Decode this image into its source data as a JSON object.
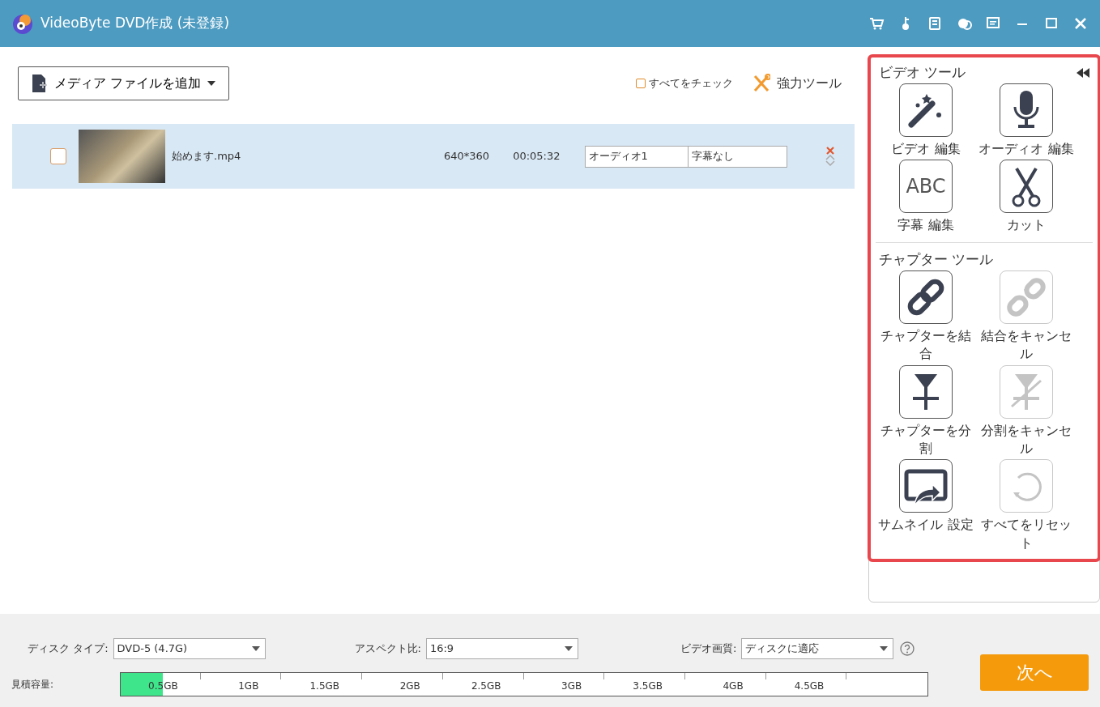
{
  "window": {
    "title": "VideoByte DVD作成 (未登録)"
  },
  "toolbar": {
    "add_media": "メディア ファイルを追加",
    "check_all": {
      "label": "すべてをチェック",
      "checked": false
    },
    "power_tools": "強力ツール"
  },
  "files": [
    {
      "name": "始めます.mp4",
      "resolution": "640*360",
      "duration": "00:05:32",
      "audio": "オーディオ1",
      "subtitle": "字幕なし",
      "checked": false,
      "selected": true
    }
  ],
  "tool_panel": {
    "sections": [
      {
        "title": "ビデオ ツール",
        "tools": [
          {
            "kind": "wand",
            "label": "ビデオ 編集",
            "disabled": false
          },
          {
            "kind": "mic",
            "label": "オーディオ 編集",
            "disabled": false
          },
          {
            "kind": "abc",
            "glyph": "ABC",
            "label": "字幕 編集",
            "disabled": false
          },
          {
            "kind": "scissors",
            "label": "カット",
            "disabled": false
          }
        ]
      },
      {
        "title": "チャプター ツール",
        "tools": [
          {
            "kind": "link",
            "label": "チャプターを結合",
            "disabled": false
          },
          {
            "kind": "unlink",
            "label": "結合をキャンセル",
            "disabled": true
          },
          {
            "kind": "split",
            "label": "チャプターを分割",
            "disabled": false
          },
          {
            "kind": "unsplit",
            "label": "分割をキャンセル",
            "disabled": true
          },
          {
            "kind": "thumb",
            "label": "サムネイル 設定",
            "disabled": false
          },
          {
            "kind": "reset",
            "label": "すべてをリセット",
            "disabled": true
          }
        ]
      }
    ]
  },
  "settings": [
    {
      "label": "ディスク タイプ:",
      "value": "DVD-5 (4.7G)"
    },
    {
      "label": "アスペクト比:",
      "value": "16:9"
    },
    {
      "label": "ビデオ画質:",
      "value": "ディスクに適応"
    }
  ],
  "capacity": {
    "label": "見積容量:",
    "level": 0.052,
    "ticks": [
      "0.5GB",
      "1GB",
      "1.5GB",
      "2GB",
      "2.5GB",
      "3GB",
      "3.5GB",
      "4GB",
      "4.5GB"
    ]
  },
  "next_button": "次へ"
}
